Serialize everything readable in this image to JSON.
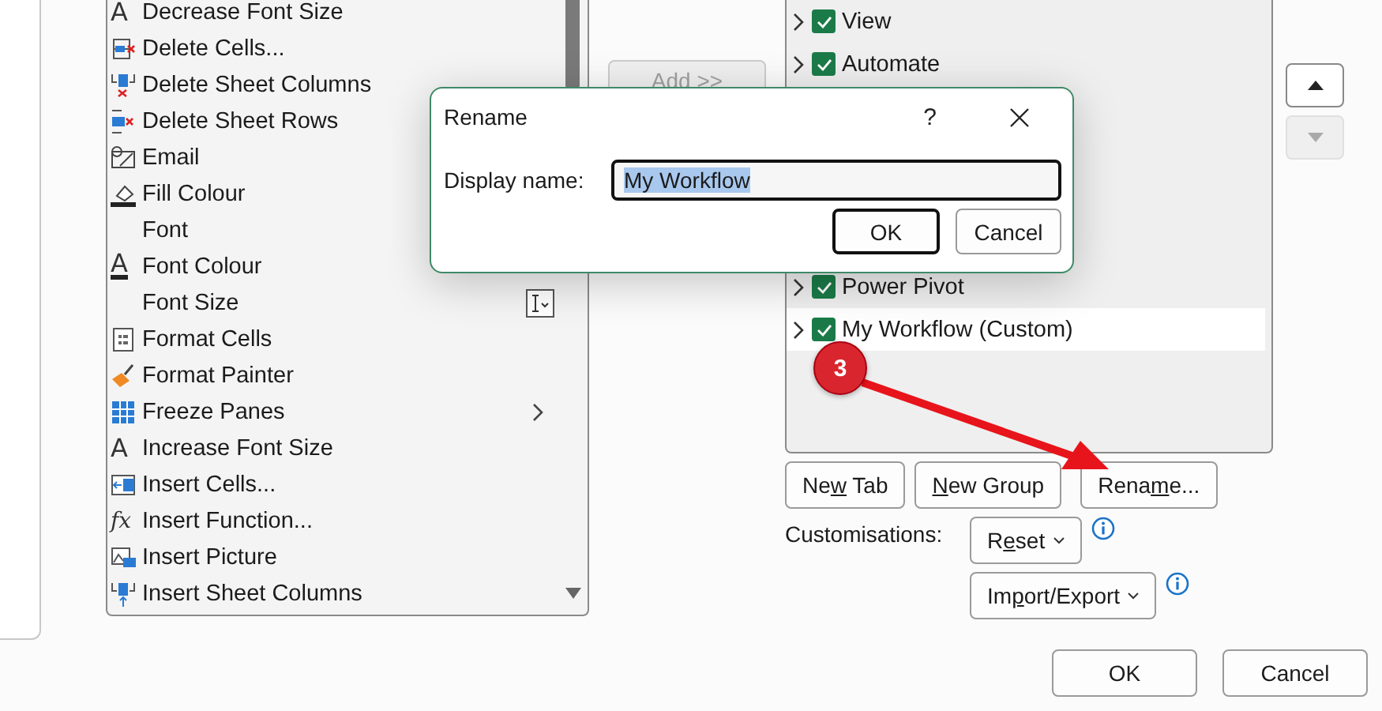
{
  "commands": {
    "items": [
      {
        "label": "Decrease Font Size",
        "kind": "command",
        "icon_glyph": "A"
      },
      {
        "label": "Delete Cells...",
        "kind": "command"
      },
      {
        "label": "Delete Sheet Columns",
        "kind": "command"
      },
      {
        "label": "Delete Sheet Rows",
        "kind": "command"
      },
      {
        "label": "Email",
        "kind": "command"
      },
      {
        "label": "Fill Colour",
        "kind": "command"
      },
      {
        "label": "Font",
        "kind": "command"
      },
      {
        "label": "Font Colour",
        "kind": "command",
        "icon_glyph": "A"
      },
      {
        "label": "Font Size",
        "kind": "picker"
      },
      {
        "label": "Format Cells",
        "kind": "command"
      },
      {
        "label": "Format Painter",
        "kind": "command"
      },
      {
        "label": "Freeze Panes",
        "kind": "submenu"
      },
      {
        "label": "Increase Font Size",
        "kind": "command",
        "icon_glyph": "A"
      },
      {
        "label": "Insert Cells...",
        "kind": "command"
      },
      {
        "label": "Insert Function...",
        "kind": "command",
        "icon_glyph": "fx"
      },
      {
        "label": "Insert Picture",
        "kind": "command"
      },
      {
        "label": "Insert Sheet Columns",
        "kind": "command"
      }
    ]
  },
  "add_button": {
    "label": "Add >>",
    "disabled": true
  },
  "ribbon_tabs": [
    {
      "label": "View",
      "checked": true,
      "selected": false
    },
    {
      "label": "Automate",
      "checked": true,
      "selected": false
    },
    {
      "label": "Power Pivot",
      "checked": true,
      "selected": false
    },
    {
      "label": "My Workflow (Custom)",
      "checked": true,
      "selected": true
    }
  ],
  "move_buttons": [
    {
      "disabled": false
    },
    {
      "disabled": true
    }
  ],
  "tab_buttons": [
    {
      "pre": "Ne",
      "key": "w",
      "post": " Tab"
    },
    {
      "key": "N",
      "post": "ew Group"
    },
    {
      "pre": "Rena",
      "key": "m",
      "post": "e..."
    }
  ],
  "customisations": {
    "label": "Customisations:",
    "buttons": [
      {
        "pre": "R",
        "key": "e",
        "post": "set"
      },
      {
        "pre": "Im",
        "key": "p",
        "post": "ort/Export"
      }
    ]
  },
  "footer_buttons": [
    {
      "label": "OK",
      "default": false
    },
    {
      "label": "Cancel",
      "default": false
    }
  ],
  "rename_dialog": {
    "title": "Rename",
    "help": "?",
    "field_label": "Display name:",
    "value": "My Workflow",
    "text_selected": true,
    "buttons": [
      {
        "label": "OK",
        "default": true
      },
      {
        "label": "Cancel",
        "default": false
      }
    ]
  },
  "annotation": {
    "number": "3"
  }
}
